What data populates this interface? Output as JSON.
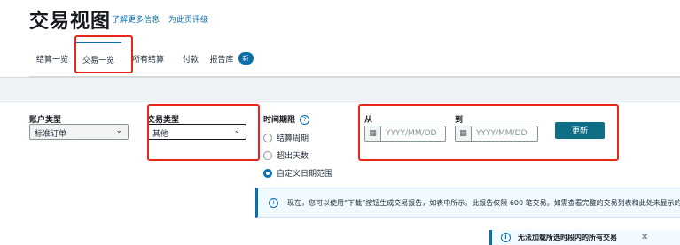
{
  "header": {
    "title": "交易视图",
    "learn_more": "了解更多信息",
    "rate_page": "为此页评级"
  },
  "tabs": [
    {
      "label": "结算一览",
      "active": false
    },
    {
      "label": "交易一览",
      "active": true
    },
    {
      "label": "所有结算",
      "active": false
    },
    {
      "label": "付款",
      "active": false
    },
    {
      "label": "报告库",
      "active": false,
      "badge": "新"
    }
  ],
  "filters": {
    "account_type": {
      "label": "账户类型",
      "value": "标准订单"
    },
    "transaction_type": {
      "label": "交易类型",
      "value": "其他"
    },
    "time_period": {
      "label": "时间期限",
      "options": [
        {
          "label": "结算周期",
          "selected": false
        },
        {
          "label": "超出天数",
          "selected": false
        },
        {
          "label": "自定义日期范围",
          "selected": true
        }
      ]
    },
    "from": {
      "label": "从",
      "placeholder": "YYYY/MM/DD"
    },
    "to": {
      "label": "到",
      "placeholder": "YYYY/MM/DD"
    },
    "update_button": "更新"
  },
  "info_banner": "现在，您可以使用“下载”按钮生成交易报告，如表中所示。此报告仅限 600 笔交易。如需查看完整的交易列表和此处未显示的",
  "notice": "无法加载所选时段内的所有交易",
  "icons": {
    "help": "help-icon",
    "info": "info-icon",
    "calendar": "calendar-icon",
    "close": "close-icon",
    "caret": "caret-down-icon"
  },
  "colors": {
    "link": "#0a6ea8",
    "primary_button": "#0f6e85",
    "highlight_box": "#e8261c",
    "band": "#eef2f4"
  }
}
